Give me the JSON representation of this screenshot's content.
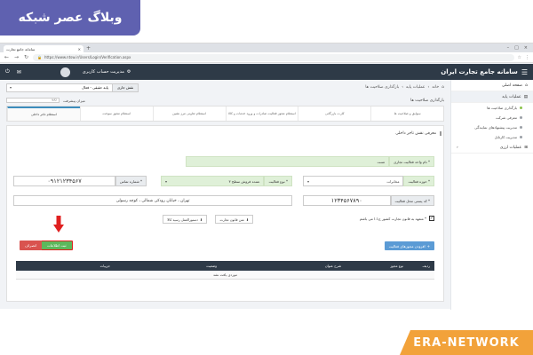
{
  "blog": {
    "title": "وبلاگ عصر شبکه"
  },
  "watermark": {
    "text": "ERA-NETWORK"
  },
  "browser": {
    "tab_title": "سامانه جامع تجارت",
    "url": "https://www.ntsw.ir/Users/Login/Verification.aspx"
  },
  "header": {
    "logo_text": "سامانه جامع تجارت ایران",
    "account_label": "مدیریت حساب کاربری"
  },
  "sidebar": {
    "items": [
      {
        "label": "صفحه اصلی"
      },
      {
        "label": "عملیات پایه"
      }
    ],
    "subitems": [
      {
        "label": "بازگذاری صلاحیت ها"
      },
      {
        "label": "معرفی شرکت"
      },
      {
        "label": "مدیریت پیشنهادهای نمایندگی"
      },
      {
        "label": "مدیریت کارتابل"
      }
    ],
    "currency_item": {
      "label": "عملیات ارزی"
    }
  },
  "breadcrumb": {
    "home": "خانه",
    "level1": "عملیات پایه",
    "level2": "بازگذاری صلاحیت ها"
  },
  "role": {
    "label": "نقش جاری",
    "value": "پایه حقیقی - فعال"
  },
  "subheader": {
    "title": "بارگذاری صلاحیت ها",
    "progress_label": "میزان پیشرفت",
    "progress_value": "۲۶٪"
  },
  "steps": [
    {
      "label": "سوابق و صلاحیت ها"
    },
    {
      "label": "کارت بازرگانی"
    },
    {
      "label": "استعلام مجوز فعالیت صادرات و ورود خدمات و کالا"
    },
    {
      "label": "استعلام تعاونی مرز نشین"
    },
    {
      "label": "استعلام مجوز سوخت"
    },
    {
      "label": "استعلام تاجر داخلی"
    }
  ],
  "form": {
    "card_title": "معرفی نقش تاجر داخلی",
    "business_name_label": "* نام واحد فعالیت تجاری",
    "business_name_value": "تست",
    "activity_area_label": "* حوزه فعالیت",
    "activity_area_value": "مخابرات",
    "activity_type_label": "* نوع فعالیت",
    "activity_type_value": "عمده فروش سطح ۳",
    "phone_label": "* شماره تماس",
    "phone_value": "۰۹۱۲۱۲۳۴۵۶۷",
    "postal_label": "* کد پستی محل فعالیت",
    "postal_value": "۱۲۳۴۵۶۷۸۹۰",
    "address_value": "تهران ، خیابان رودکی شمالی ، کوچه رسولی",
    "commitment_text": "* متعهد به قانون تجارت کشور ج.ا.ا می باشم",
    "law_button": "متن قانون تجارت",
    "receipt_button": "دستورالعمل رسید کالا",
    "add_license_button": "افزودن مجوزهای فعالیت",
    "submit_button": "ثبت اطلاعات",
    "cancel_button": "انصراف"
  },
  "table": {
    "headers": [
      "ردیف",
      "نوع مجوز",
      "شرح عنوان",
      "وضعیت",
      "جزییات"
    ],
    "empty_text": "موردی یافت نشد"
  }
}
